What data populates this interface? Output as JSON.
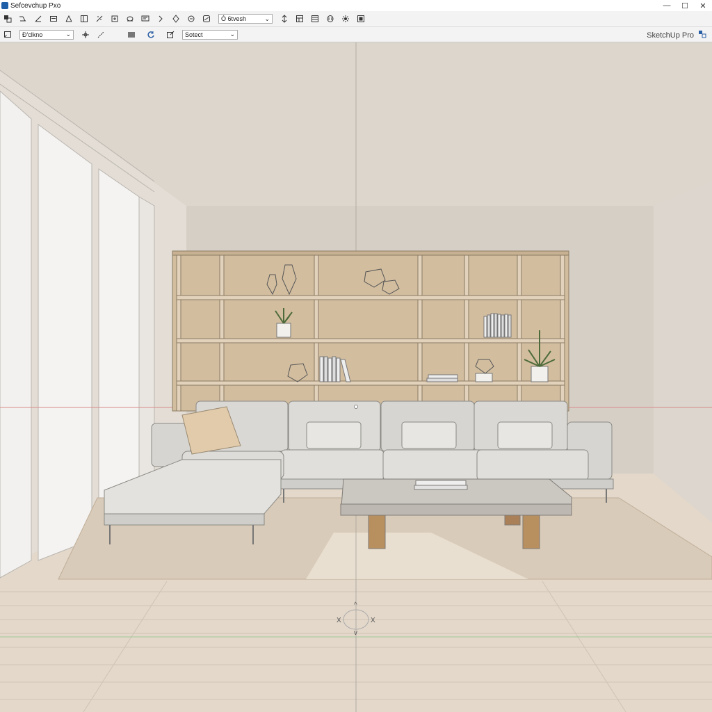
{
  "window": {
    "title": "Sefcevchup Pxo",
    "controls": {
      "minimize": "—",
      "maximize": "☐",
      "close": "✕"
    }
  },
  "toolbar1": {
    "search_dropdown": {
      "value": "Ó 6tvesh",
      "arrow": "⌄"
    }
  },
  "toolbar2": {
    "style_dropdown": {
      "value": "Ð'clkno",
      "arrow": "⌄"
    },
    "select_dropdown": {
      "value": "Sotect",
      "arrow": "⌄"
    }
  },
  "brand": {
    "label": "SketchUp Pro"
  },
  "viewport": {
    "axis_labels": {
      "top": "^",
      "left": "X",
      "right": "X",
      "bottom": "v"
    }
  },
  "colors": {
    "ceiling": "#ded7ce",
    "wall": "#d7d0c7",
    "floor": "#e2d6c7",
    "rug": "#dccfbf",
    "shelf_wood": "#cfb99b",
    "sofa": "#d9d8d4",
    "table_top": "#cbc7c1",
    "table_leg": "#b88f5f",
    "axis_red": "#d98a8a",
    "axis_green": "#8ac58a"
  }
}
